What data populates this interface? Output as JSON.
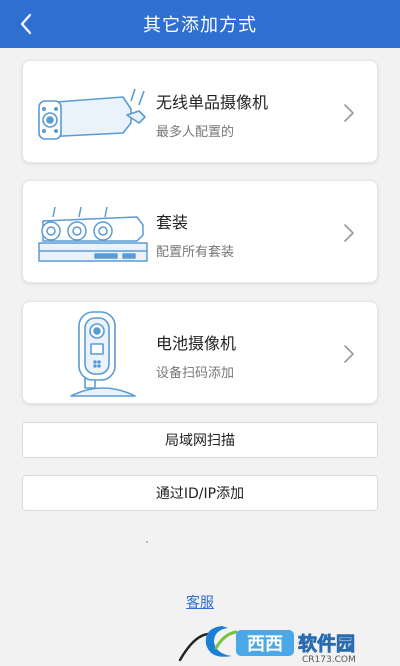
{
  "header": {
    "title": "其它添加方式",
    "back_icon": "chevron-left-icon"
  },
  "options": [
    {
      "name": "无线单品摄像机",
      "desc": "最多人配置的",
      "icon": "wireless-bullet-camera-icon"
    },
    {
      "name": "套装",
      "desc": "配置所有套装",
      "icon": "camera-kit-nvr-icon"
    },
    {
      "name": "电池摄像机",
      "desc": "设备扫码添加",
      "icon": "battery-camera-icon"
    }
  ],
  "buttons": {
    "lan_scan": "局域网扫描",
    "add_by_id": "通过ID/IP添加"
  },
  "footer": {
    "support_link": "客服"
  },
  "watermark": {
    "brand_text": "西西软件园",
    "site_text": "CR173.COM"
  },
  "colors": {
    "accent": "#2f6fd0",
    "background": "#f2f2f2",
    "line_art": "#5b9bd5"
  }
}
